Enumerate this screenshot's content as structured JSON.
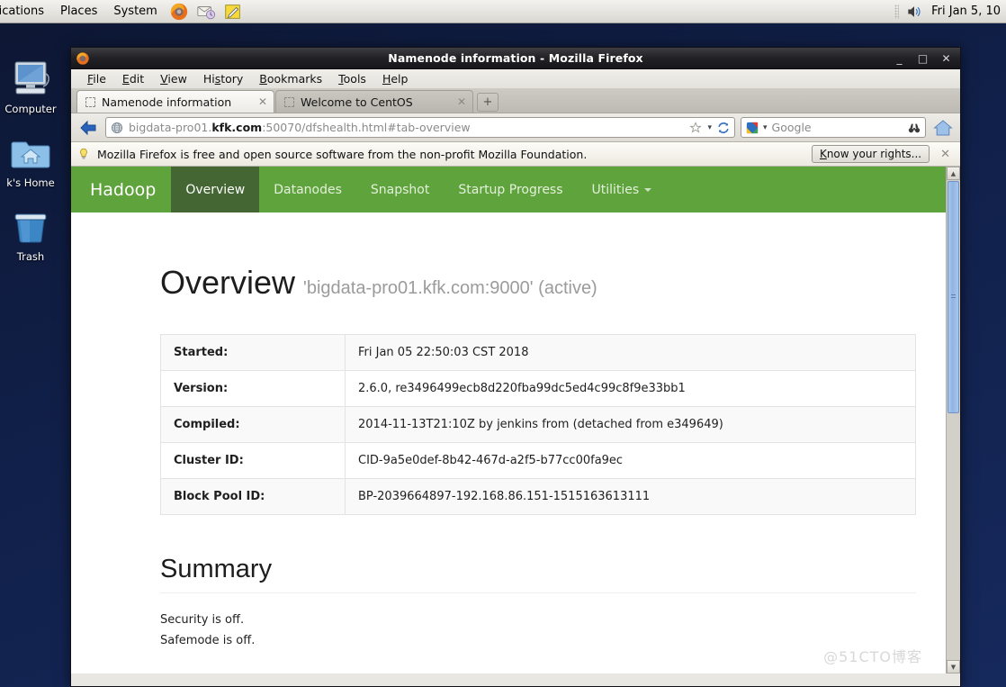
{
  "panel": {
    "menus": [
      "lications",
      "Places",
      "System"
    ],
    "launchers": [
      "firefox-icon",
      "evolution-mail-icon",
      "notes-editor-icon"
    ],
    "volume_icon": "volume-icon",
    "clock": "Fri Jan  5, 10"
  },
  "desktop": {
    "icons": [
      {
        "name": "computer-icon",
        "label": "Computer"
      },
      {
        "name": "home-folder-icon",
        "label": "k's Home"
      },
      {
        "name": "trash-icon",
        "label": "Trash"
      }
    ]
  },
  "window": {
    "title": "Namenode information - Mozilla Firefox",
    "icon": "firefox-icon",
    "minimize": "_",
    "maximize": "□",
    "close": "✕"
  },
  "menubar": [
    {
      "pre": "",
      "accel": "F",
      "post": "ile"
    },
    {
      "pre": "",
      "accel": "E",
      "post": "dit"
    },
    {
      "pre": "",
      "accel": "V",
      "post": "iew"
    },
    {
      "pre": "Hi",
      "accel": "s",
      "post": "tory"
    },
    {
      "pre": "",
      "accel": "B",
      "post": "ookmarks"
    },
    {
      "pre": "",
      "accel": "T",
      "post": "ools"
    },
    {
      "pre": "",
      "accel": "H",
      "post": "elp"
    }
  ],
  "tabs": [
    {
      "title": "Namenode information",
      "active": true,
      "close": "✕"
    },
    {
      "title": "Welcome to CentOS",
      "active": false,
      "close": "✕"
    }
  ],
  "newtab_label": "+",
  "navbar": {
    "back_icon": "back-arrow-icon",
    "site_icon": "globe-icon",
    "url_prefix": "bigdata-pro01.",
    "url_host": "kfk.com",
    "url_suffix": ":50070/dfshealth.html#tab-overview",
    "bookmark_icon": "star-icon",
    "bookmark_chevron": "▾",
    "reload_icon": "reload-icon",
    "search_engine_icon": "google-icon",
    "search_chevron": "▾",
    "search_placeholder": "Google",
    "search_value": "",
    "search_submit_icon": "binoculars-icon",
    "home_icon": "home-icon"
  },
  "notification": {
    "icon": "lightbulb-icon",
    "text": "Mozilla Firefox is free and open source software from the non-profit Mozilla Foundation.",
    "button_pre": "",
    "button_accel": "K",
    "button_post": "now your rights...",
    "close": "✕"
  },
  "hadoop": {
    "brand": "Hadoop",
    "nav": [
      {
        "label": "Overview",
        "active": true,
        "caret": false
      },
      {
        "label": "Datanodes",
        "active": false,
        "caret": false
      },
      {
        "label": "Snapshot",
        "active": false,
        "caret": false
      },
      {
        "label": "Startup Progress",
        "active": false,
        "caret": false
      },
      {
        "label": "Utilities",
        "active": false,
        "caret": true
      }
    ],
    "accent_green": "#5fa33c",
    "accent_green_active": "#446633"
  },
  "overview": {
    "heading": "Overview",
    "subheading": "'bigdata-pro01.kfk.com:9000' (active)",
    "table": [
      {
        "key": "Started:",
        "value": "Fri Jan 05 22:50:03 CST 2018"
      },
      {
        "key": "Version:",
        "value": "2.6.0, re3496499ecb8d220fba99dc5ed4c99c8f9e33bb1"
      },
      {
        "key": "Compiled:",
        "value": "2014-11-13T21:10Z by jenkins from (detached from e349649)"
      },
      {
        "key": "Cluster ID:",
        "value": "CID-9a5e0def-8b42-467d-a2f5-b77cc00fa9ec"
      },
      {
        "key": "Block Pool ID:",
        "value": "BP-2039664897-192.168.86.151-1515163613111"
      }
    ]
  },
  "summary": {
    "heading": "Summary",
    "lines": [
      "Security is off.",
      "Safemode is off."
    ]
  },
  "watermark": "@51CTO博客",
  "scrollbar": {
    "up_arrow": "▲",
    "down_arrow": "▼"
  }
}
